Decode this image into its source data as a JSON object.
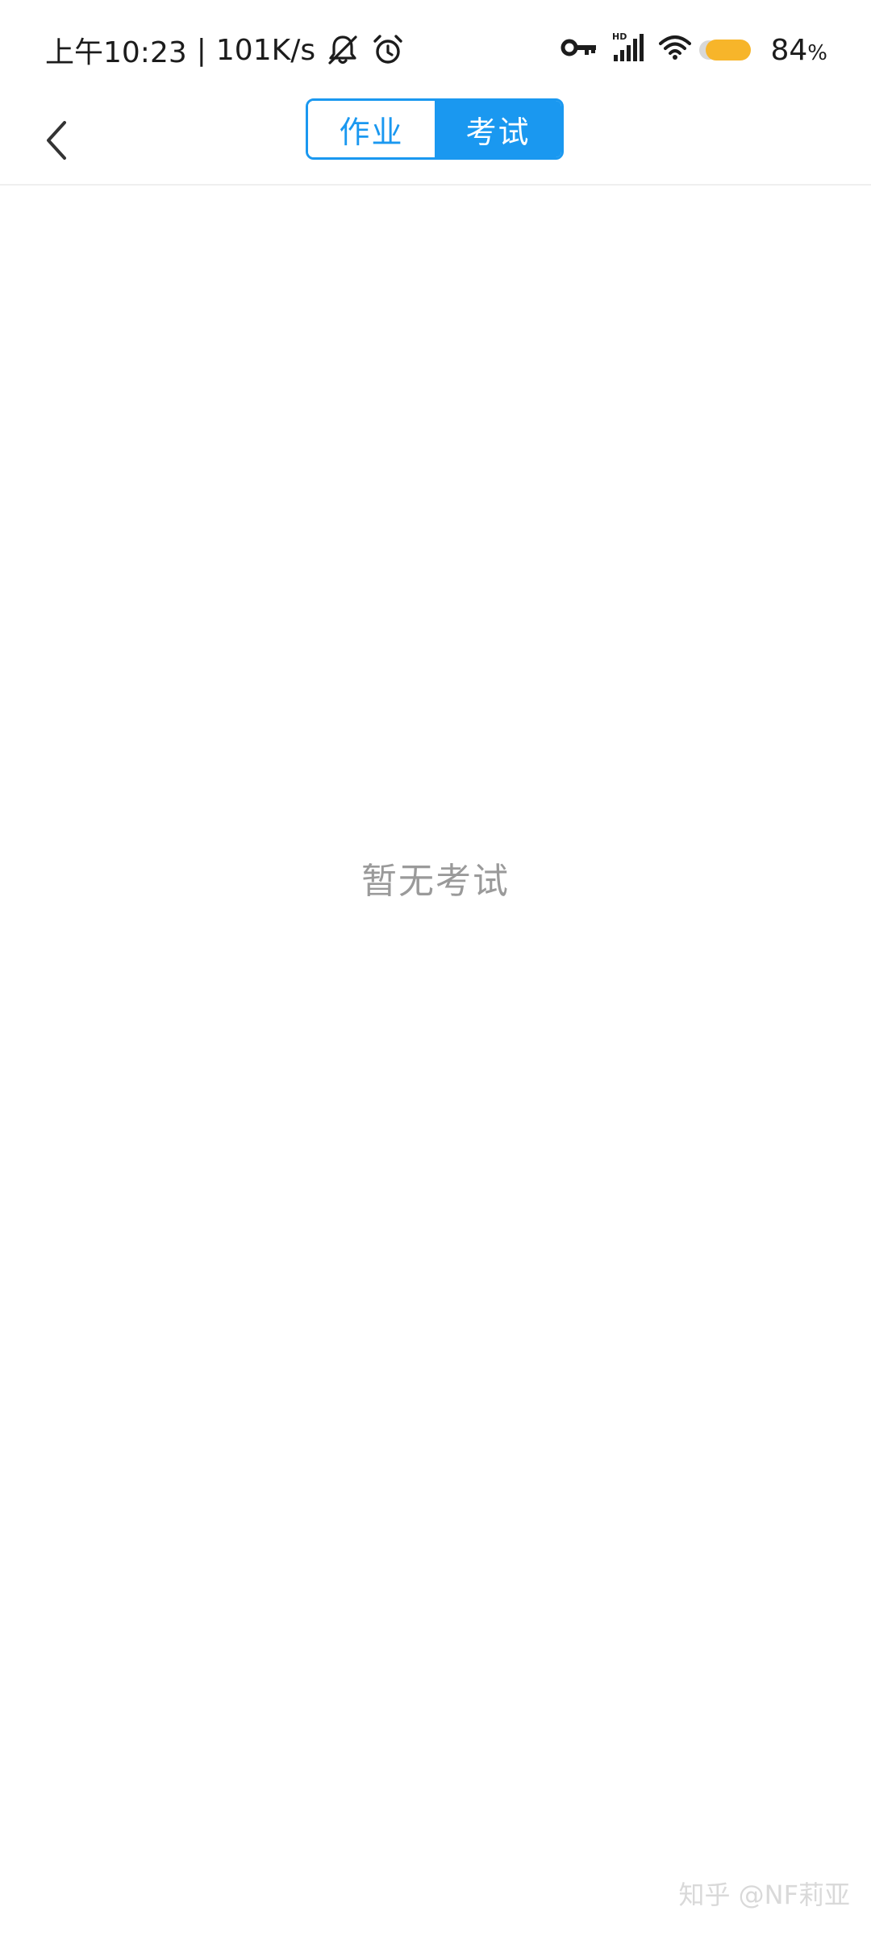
{
  "status_bar": {
    "time": "上午10:23",
    "separator": "|",
    "net_speed": "101K/s",
    "battery_percent": "84",
    "battery_symbol": "%",
    "icons": [
      "bell-muted-icon",
      "alarm-icon",
      "vpn-key-icon",
      "hd-signal-icon",
      "wifi-icon",
      "battery-icon"
    ],
    "battery_color": "#f7b52a"
  },
  "nav": {
    "back_icon": "chevron-left-icon",
    "tabs": [
      {
        "label": "作业",
        "active": false
      },
      {
        "label": "考试",
        "active": true
      }
    ],
    "accent_color": "#1a98f0"
  },
  "content": {
    "empty_message": "暂无考试"
  },
  "watermark": {
    "text": "知乎 @NF莉亚"
  }
}
